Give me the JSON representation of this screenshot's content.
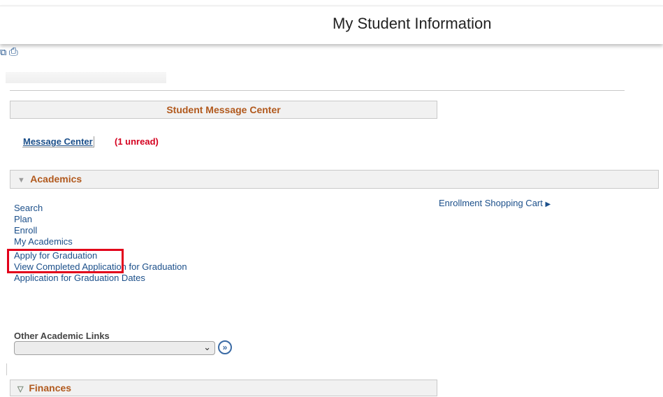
{
  "header": {
    "title": "My Student Information"
  },
  "toolbar": {
    "icons": [
      "new-window-icon",
      "print-icon"
    ],
    "new_window_glyph": "⧉",
    "print_glyph": "⎙"
  },
  "message_center": {
    "heading": "Student Message Center",
    "link_label": "Message Center",
    "unread": "(1 unread)"
  },
  "academics": {
    "heading": "Academics",
    "links": [
      "Search",
      "Plan",
      "Enroll",
      "My Academics",
      "Apply for Graduation",
      "View Completed Application for Graduation",
      "Application for Graduation Dates"
    ],
    "cart_link": "Enrollment Shopping Cart",
    "cart_arrow": "▶",
    "other_links_label": "Other Academic Links",
    "other_links_selected": "",
    "go_glyph": "»"
  },
  "finance": {
    "heading": "Finances"
  },
  "colors": {
    "accent": "#b1591d",
    "link": "#1b4f8a",
    "alert": "#d4001f",
    "highlight": "#e2001a"
  }
}
